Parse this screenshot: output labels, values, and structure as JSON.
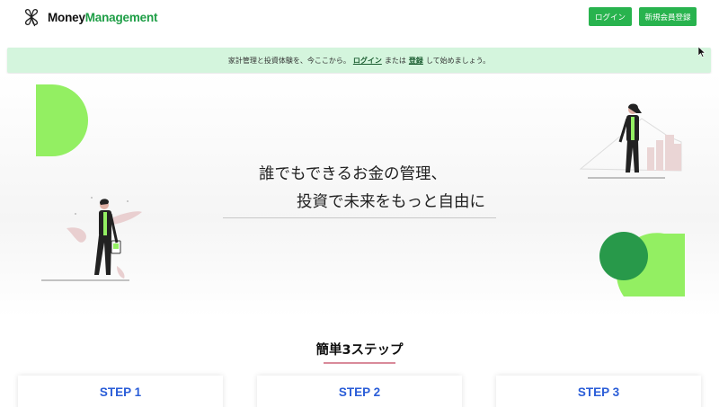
{
  "header": {
    "logo_word1": "Money",
    "logo_word2": "Management",
    "login_button": "ログイン",
    "register_button": "新規会員登録"
  },
  "notice": {
    "prefix": "家計管理と投資体験を、今ここから。",
    "login_link": "ログイン",
    "middle": "または",
    "register_link": "登録",
    "suffix": "して始めましょう。"
  },
  "hero": {
    "line1": "誰でもできるお金の管理、",
    "line2": "投資で未来をもっと自由に"
  },
  "steps": {
    "title": "簡単3ステップ",
    "cards": [
      "STEP 1",
      "STEP 2",
      "STEP 3"
    ]
  },
  "colors": {
    "brand_green": "#28b34e",
    "logo_green": "#1e9e46",
    "light_green": "#93ef62",
    "dark_green": "#28994a",
    "notice_bg": "#d4f5dd",
    "step_blue": "#2b5ed8",
    "accent_pink": "#d98a9a"
  },
  "icons": {
    "logo": "clover-icon",
    "cursor": "mouse-pointer-icon"
  }
}
